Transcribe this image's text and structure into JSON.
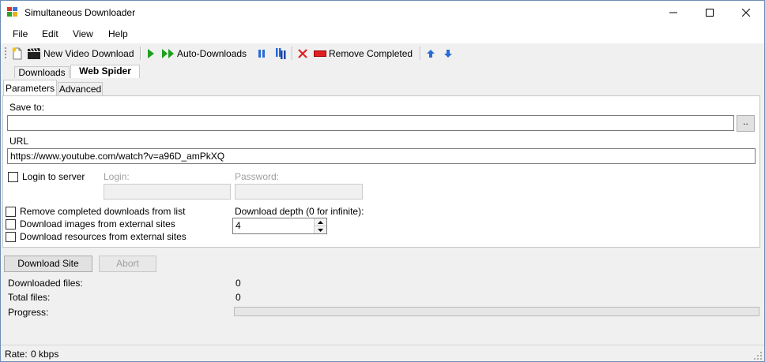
{
  "window": {
    "title": "Simultaneous Downloader"
  },
  "menu": {
    "file": "File",
    "edit": "Edit",
    "view": "View",
    "help": "Help"
  },
  "toolbar": {
    "new_video": "New Video Download",
    "auto_downloads": "Auto-Downloads",
    "remove_completed": "Remove Completed"
  },
  "tabs": {
    "downloads": "Downloads",
    "web_spider": "Web Spider"
  },
  "subtabs": {
    "parameters": "Parameters",
    "advanced": "Advanced"
  },
  "form": {
    "save_to_label": "Save to:",
    "save_to_value": "",
    "browse_label": "..",
    "url_label": "URL",
    "url_value": "https://www.youtube.com/watch?v=a96D_amPkXQ",
    "login_to_server": "Login to server",
    "login_label": "Login:",
    "login_value": "",
    "password_label": "Password:",
    "password_value": "",
    "remove_completed_list": "Remove completed downloads from list",
    "download_images_external": "Download images from external sites",
    "download_resources_external": "Download resources from external sites",
    "depth_label": "Download depth (0 for infinite):",
    "depth_value": "4"
  },
  "actions": {
    "download_site": "Download Site",
    "abort": "Abort"
  },
  "stats": {
    "downloaded_files_label": "Downloaded files:",
    "downloaded_files_value": "0",
    "total_files_label": "Total files:",
    "total_files_value": "0",
    "progress_label": "Progress:",
    "progress_value": 0
  },
  "status": {
    "rate_label": "Rate:",
    "rate_value": "0 kbps"
  },
  "colors": {
    "window_border": "#6b8db3",
    "play_green": "#1ea01e",
    "remove_red": "#e02020",
    "arrow_blue": "#2a6ad6"
  }
}
